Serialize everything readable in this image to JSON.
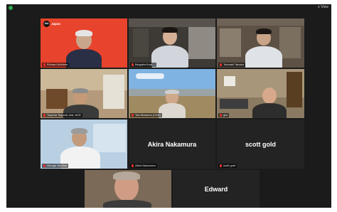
{
  "window": {
    "view_label": "≡ View"
  },
  "participants": [
    {
      "id": "richard",
      "name": "Richard Mohlere",
      "badge_logo": "AIA",
      "badge_text": "Japan"
    },
    {
      "id": "tile2",
      "name": "Bergaim Kom..."
    },
    {
      "id": "tile3",
      "name": "Tomoaki Tanaka"
    },
    {
      "id": "tile4",
      "name": "Toyama Taguchi, AIA, NCE"
    },
    {
      "id": "tile5",
      "name": "Tom Brannon (USA)"
    },
    {
      "id": "tile6",
      "name": "gke"
    },
    {
      "id": "george",
      "name": "George Sunthal"
    },
    {
      "id": "akira",
      "name": "Akira Nakamura",
      "display": "Akira Nakamura"
    },
    {
      "id": "scott",
      "name": "scott gold",
      "display": "scott gold"
    },
    {
      "id": "tile10",
      "name": ""
    },
    {
      "id": "edward",
      "name": "Edward",
      "display": "Edward"
    }
  ],
  "colors": {
    "active_speaker_outline": "#c9e14c",
    "muted_mic": "#e0322f",
    "aia_tile_bg": "#e8432c"
  },
  "icons": {
    "status": "shield-icon",
    "mic": "mic-muted-icon"
  }
}
